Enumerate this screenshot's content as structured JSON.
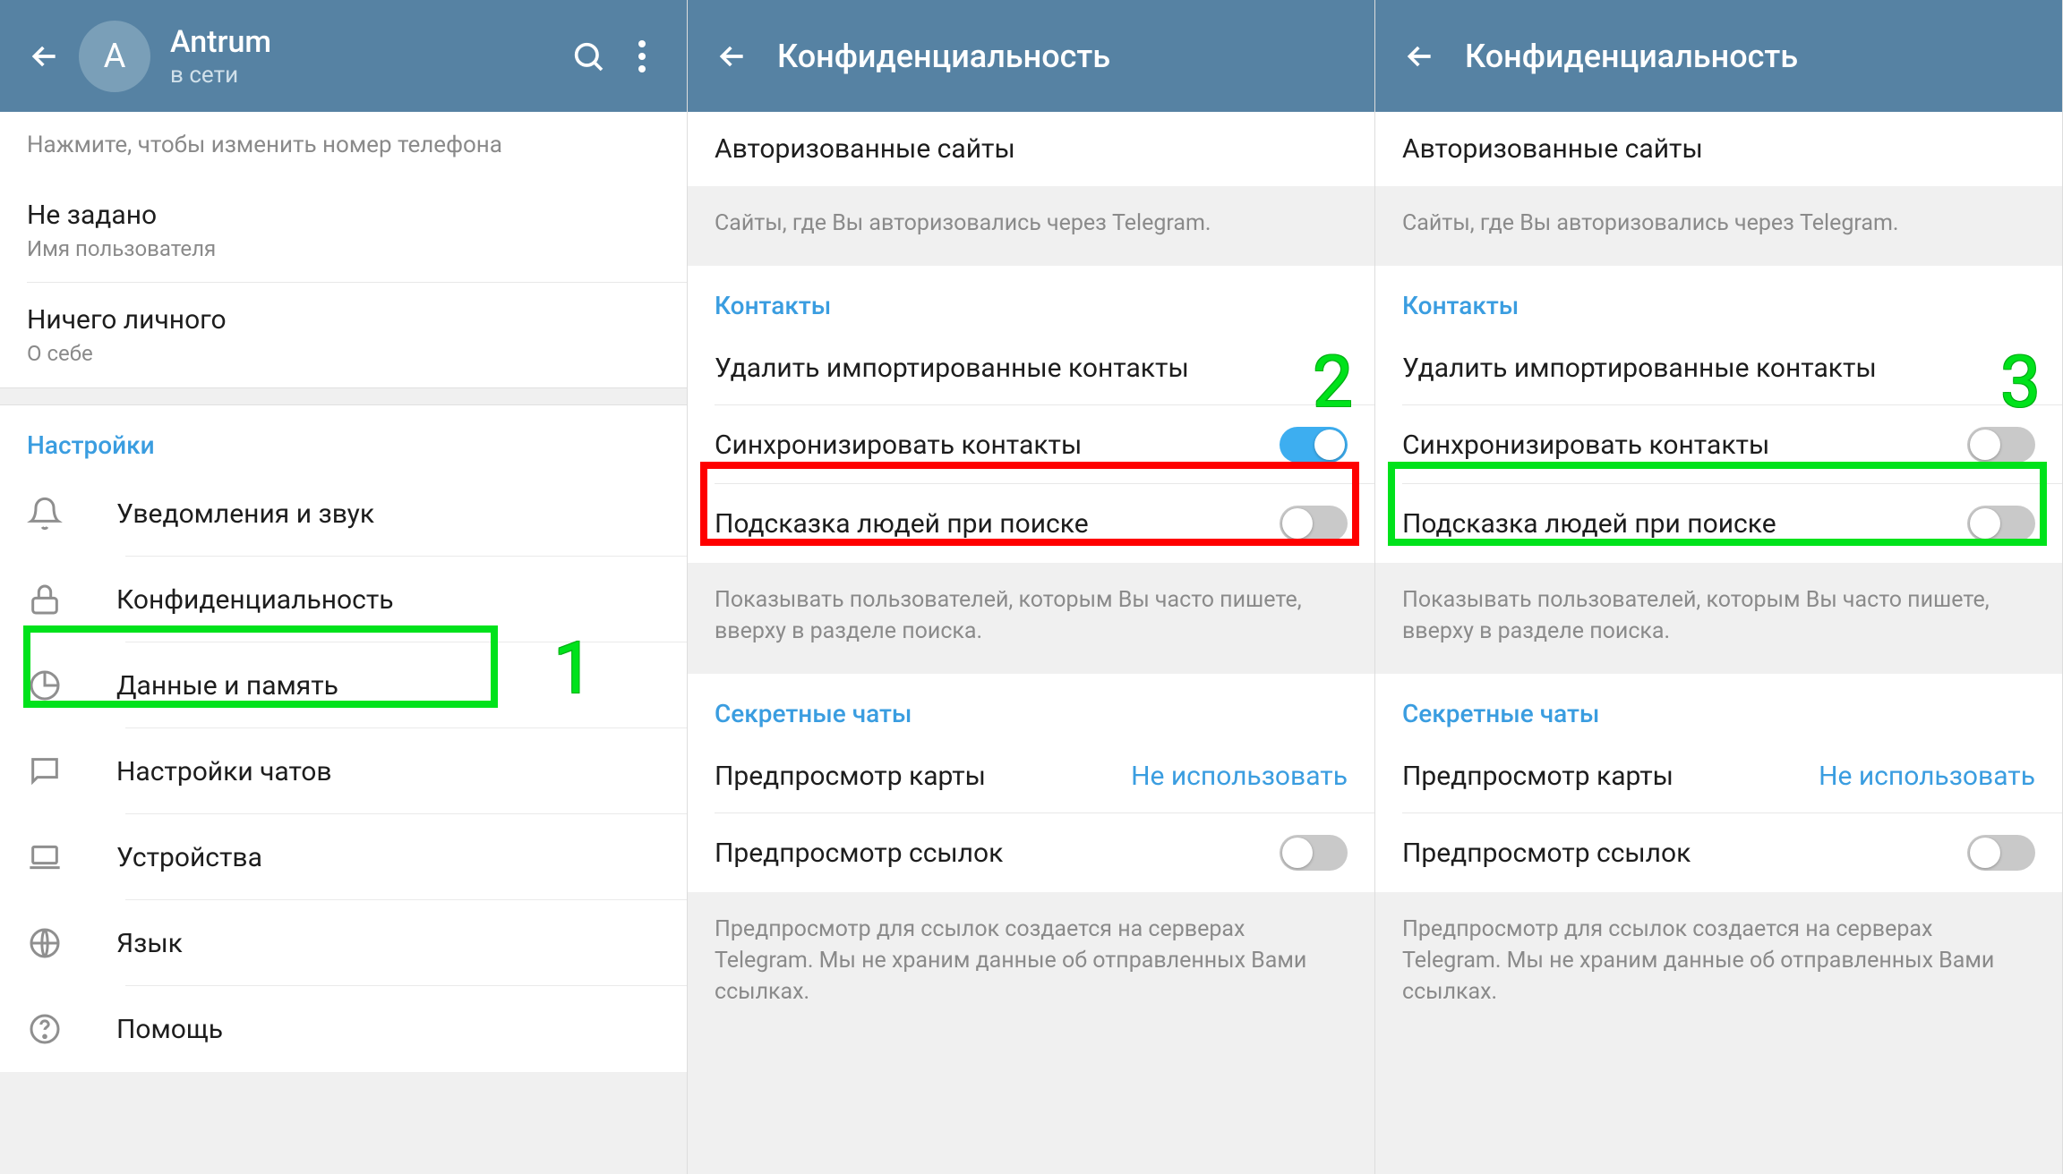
{
  "panel1": {
    "avatar_letter": "А",
    "user_name": "Antrum",
    "user_status": "в сети",
    "phone_hint": "Нажмите, чтобы изменить номер телефона",
    "username_value": "Не задано",
    "username_label": "Имя пользователя",
    "bio_value": "Ничего личного",
    "bio_label": "О себе",
    "settings_title": "Настройки",
    "items": {
      "notifications": "Уведомления и звук",
      "privacy": "Конфиденциальность",
      "data": "Данные и память",
      "chat": "Настройки чатов",
      "devices": "Устройства",
      "language": "Язык",
      "help": "Помощь"
    },
    "anno": "1"
  },
  "privacy": {
    "title": "Конфиденциальность",
    "auth_sites": "Авторизованные сайты",
    "auth_sites_hint": "Сайты, где Вы авторизовались через Telegram.",
    "contacts_title": "Контакты",
    "delete_contacts": "Удалить импортированные контакты",
    "sync_contacts": "Синхронизировать контакты",
    "suggest_people": "Подсказка людей при поиске",
    "suggest_hint": "Показывать пользователей, которым Вы часто пишете, вверху в разделе поиска.",
    "secret_title": "Секретные чаты",
    "map_preview": "Предпросмотр карты",
    "map_value": "Не использовать",
    "link_preview": "Предпросмотр ссылок",
    "link_hint": "Предпросмотр для ссылок создается на серверах Telegram. Мы не храним данные об отправленных Вами ссылках."
  },
  "panel2_anno": "2",
  "panel3_anno": "3"
}
